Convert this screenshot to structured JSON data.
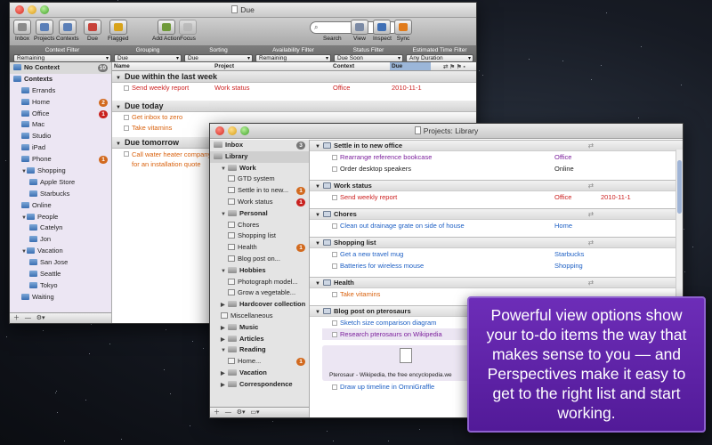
{
  "win1": {
    "title": "Due",
    "toolbar": [
      {
        "label": "Inbox",
        "icon": "inbox-icon"
      },
      {
        "label": "Projects",
        "icon": "projects-icon"
      },
      {
        "label": "Contexts",
        "icon": "contexts-icon"
      },
      {
        "label": "Due",
        "icon": "due-icon"
      },
      {
        "label": "Flagged",
        "icon": "flag-icon"
      },
      {
        "label": "Add Action",
        "icon": "add-action-icon"
      },
      {
        "label": "Focus",
        "icon": "focus-icon"
      },
      {
        "label": "View",
        "icon": "view-icon"
      },
      {
        "label": "Inspect",
        "icon": "inspect-icon"
      },
      {
        "label": "Sync",
        "icon": "sync-icon"
      }
    ],
    "search_label": "Search",
    "filters": [
      {
        "label": "Context Filter",
        "value": "Remaining"
      },
      {
        "label": "Grouping",
        "value": "Due"
      },
      {
        "label": "Sorting",
        "value": "Due"
      },
      {
        "label": "Availability Filter",
        "value": "Remaining"
      },
      {
        "label": "Status Filter",
        "value": "Due Soon"
      },
      {
        "label": "Estimated Time Filter",
        "value": "Any Duration"
      }
    ],
    "sidebar": [
      {
        "label": "No Context",
        "badge": "10",
        "level": 0,
        "kind": "nocontext",
        "bold": true
      },
      {
        "label": "Contexts",
        "level": 0,
        "kind": "header",
        "bold": true
      },
      {
        "label": "Errands",
        "level": 1
      },
      {
        "label": "Home",
        "level": 1,
        "badge": "2",
        "bc": "orange"
      },
      {
        "label": "Office",
        "level": 1,
        "badge": "1",
        "bc": "red"
      },
      {
        "label": "Mac",
        "level": 1
      },
      {
        "label": "Studio",
        "level": 1
      },
      {
        "label": "iPad",
        "level": 1
      },
      {
        "label": "Phone",
        "level": 1,
        "badge": "1",
        "bc": "orange"
      },
      {
        "label": "Shopping",
        "level": 1,
        "tri": true
      },
      {
        "label": "Apple Store",
        "level": 2
      },
      {
        "label": "Starbucks",
        "level": 2
      },
      {
        "label": "Online",
        "level": 1
      },
      {
        "label": "People",
        "level": 1,
        "tri": true
      },
      {
        "label": "Catelyn",
        "level": 2
      },
      {
        "label": "Jon",
        "level": 2
      },
      {
        "label": "Vacation",
        "level": 1,
        "tri": true
      },
      {
        "label": "San Jose",
        "level": 2
      },
      {
        "label": "Seattle",
        "level": 2
      },
      {
        "label": "Tokyo",
        "level": 2
      },
      {
        "label": "Waiting",
        "level": 1
      }
    ],
    "columns": {
      "name": "Name",
      "project": "Project",
      "context": "Context",
      "due": "Due"
    },
    "groups": [
      {
        "title": "Due within the last week",
        "tasks": [
          {
            "name": "Send weekly report",
            "project": "Work status",
            "context": "Office",
            "due": "2010-11-1",
            "color": "red"
          }
        ]
      },
      {
        "title": "Due today",
        "tasks": [
          {
            "name": "Get inbox to zero",
            "color": "orange"
          },
          {
            "name": "Take vitamins",
            "color": "orange"
          }
        ]
      },
      {
        "title": "Due tomorrow",
        "tasks": [
          {
            "name": "Call water heater company for an installation quote",
            "color": "orange"
          }
        ]
      }
    ]
  },
  "win2": {
    "title": "Projects: Library",
    "sidebar": [
      {
        "label": "Inbox",
        "badge": "3",
        "kind": "inbox",
        "bold": true
      },
      {
        "label": "Library",
        "kind": "library",
        "bold": true,
        "selected": true
      },
      {
        "label": "Work",
        "kind": "folder",
        "level": 1,
        "bold": true
      },
      {
        "label": "GTD system",
        "kind": "proj",
        "level": 2
      },
      {
        "label": "Settle in to new...",
        "kind": "proj",
        "level": 2,
        "badge": "1",
        "bc": "orange"
      },
      {
        "label": "Work status",
        "kind": "proj",
        "level": 2,
        "badge": "1",
        "bc": "red"
      },
      {
        "label": "Personal",
        "kind": "folder",
        "level": 1,
        "bold": true
      },
      {
        "label": "Chores",
        "kind": "proj",
        "level": 2
      },
      {
        "label": "Shopping list",
        "kind": "proj",
        "level": 2
      },
      {
        "label": "Health",
        "kind": "proj",
        "level": 2,
        "badge": "1",
        "bc": "orange"
      },
      {
        "label": "Blog post on...",
        "kind": "proj",
        "level": 2
      },
      {
        "label": "Hobbies",
        "kind": "folder",
        "level": 1,
        "bold": true
      },
      {
        "label": "Photograph model...",
        "kind": "proj",
        "level": 2
      },
      {
        "label": "Grow a vegetable...",
        "kind": "proj",
        "level": 2
      },
      {
        "label": "Hardcover collection",
        "kind": "folder",
        "level": 1,
        "bold": true
      },
      {
        "label": "Miscellaneous",
        "kind": "proj",
        "level": 1
      },
      {
        "label": "Music",
        "kind": "folder",
        "level": 1,
        "bold": true
      },
      {
        "label": "Articles",
        "kind": "folder",
        "level": 1,
        "bold": true
      },
      {
        "label": "Reading",
        "kind": "folder",
        "level": 1,
        "bold": true
      },
      {
        "label": "Home...",
        "kind": "proj",
        "level": 2,
        "badge": "1",
        "bc": "orange"
      },
      {
        "label": "Vacation",
        "kind": "folder",
        "level": 1,
        "bold": true
      },
      {
        "label": "Correspondence",
        "kind": "folder",
        "level": 1,
        "bold": true
      }
    ],
    "projects": [
      {
        "title": "Settle in to new office",
        "tasks": [
          {
            "name": "Rearrange reference bookcase",
            "context": "Office",
            "color": "purple"
          },
          {
            "name": "Order desktop speakers",
            "context": "Online",
            "color": "black"
          }
        ]
      },
      {
        "title": "Work status",
        "tasks": [
          {
            "name": "Send weekly report",
            "context": "Office",
            "due": "2010-11-1",
            "color": "red"
          }
        ]
      },
      {
        "title": "Chores",
        "tasks": [
          {
            "name": "Clean out drainage grate on side of house",
            "context": "Home",
            "color": "blue"
          }
        ]
      },
      {
        "title": "Shopping list",
        "tasks": [
          {
            "name": "Get a new travel mug",
            "context": "Starbucks",
            "color": "blue"
          },
          {
            "name": "Batteries for wireless mouse",
            "context": "Shopping",
            "color": "blue"
          }
        ]
      },
      {
        "title": "Health",
        "tasks": [
          {
            "name": "Take vitamins",
            "color": "orange"
          }
        ]
      },
      {
        "title": "Blog post on pterosaurs",
        "tasks": [
          {
            "name": "Sketch size comparison diagram",
            "color": "blue"
          },
          {
            "name": "Research pterosaurs on Wikipedia",
            "color": "purple"
          }
        ]
      }
    ],
    "attachment_caption": "Pterosaur - Wikipedia, the free encyclopedia.we",
    "last_task": "Draw up timeline in OmniGraffle"
  },
  "callout": "Powerful view options show your to-do items the way that makes sense to you — and Perspectives make it easy to get to the right list and start working."
}
